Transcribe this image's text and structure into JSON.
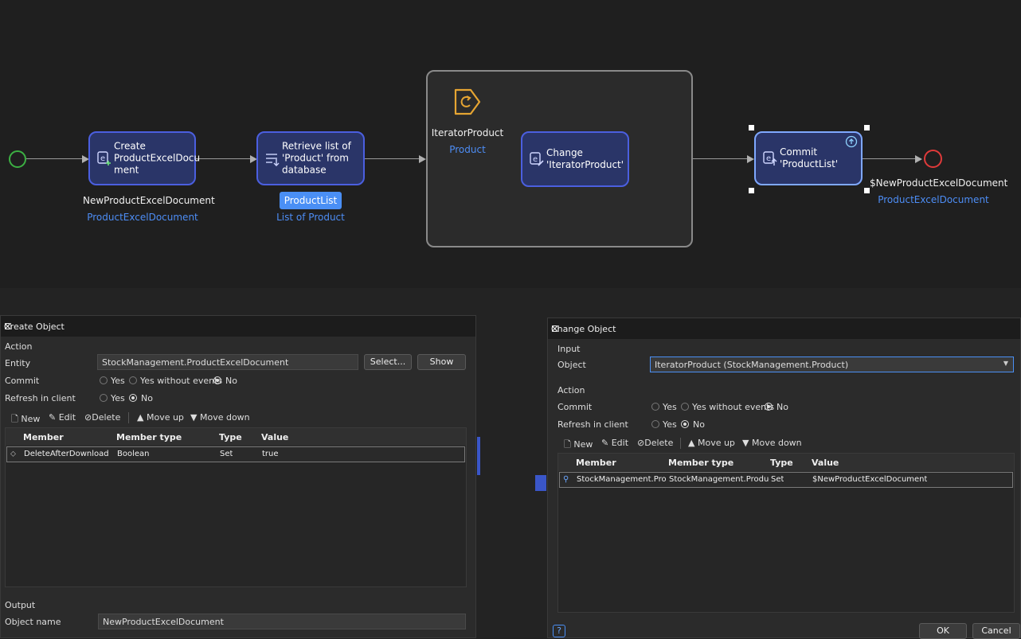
{
  "flow": {
    "create_node": "Create ProductExcelDocu ment",
    "create_var": "NewProductExcelDocument",
    "create_type": "ProductExcelDocument",
    "retrieve_node": "Retrieve list of 'Product' from database",
    "retrieve_var": "ProductList",
    "retrieve_type": "List of Product",
    "iterator_name": "IteratorProduct",
    "iterator_type": "Product",
    "change_node": "Change 'IteratorProduct'",
    "commit_node": "Commit 'ProductList'",
    "end_var": "$NewProductExcelDocument",
    "end_type": "ProductExcelDocument",
    "colors": {
      "start": "#3cb043",
      "end": "#e03a3a",
      "node_border": "#4b5fe0",
      "loop_icon": "#e6a532"
    }
  },
  "create_dialog": {
    "title": "Create Object",
    "action_label": "Action",
    "entity_label": "Entity",
    "entity_value": "StockManagement.ProductExcelDocument",
    "select_btn": "Select...",
    "show_btn": "Show",
    "commit_label": "Commit",
    "commit_yes": "Yes",
    "commit_yes_no_events": "Yes without events",
    "commit_no": "No",
    "refresh_label": "Refresh in client",
    "refresh_yes": "Yes",
    "refresh_no": "No",
    "toolbar": {
      "new": "New",
      "edit": "Edit",
      "delete": "Delete",
      "move_up": "Move up",
      "move_down": "Move down"
    },
    "columns": [
      "Member",
      "Member type",
      "Type",
      "Value"
    ],
    "rows": [
      [
        "DeleteAfterDownload",
        "Boolean",
        "Set",
        "true"
      ]
    ],
    "output_label": "Output",
    "object_name_label": "Object name",
    "object_name_value": "NewProductExcelDocument"
  },
  "change_dialog": {
    "title": "Change Object",
    "input_label": "Input",
    "object_label": "Object",
    "object_value": "IteratorProduct (StockManagement.Product)",
    "action_label": "Action",
    "commit_label": "Commit",
    "commit_yes": "Yes",
    "commit_yes_no_events": "Yes without events",
    "commit_no": "No",
    "refresh_label": "Refresh in client",
    "refresh_yes": "Yes",
    "refresh_no": "No",
    "toolbar": {
      "new": "New",
      "edit": "Edit",
      "delete": "Delete",
      "move_up": "Move up",
      "move_down": "Move down"
    },
    "columns": [
      "Member",
      "Member type",
      "Type",
      "Value"
    ],
    "rows": [
      [
        "StockManagement.Produ...",
        "StockManagement.ProductE...",
        "Set",
        "$NewProductExcelDocument"
      ]
    ],
    "help": "?",
    "ok_btn": "OK",
    "cancel_btn": "Cancel"
  }
}
